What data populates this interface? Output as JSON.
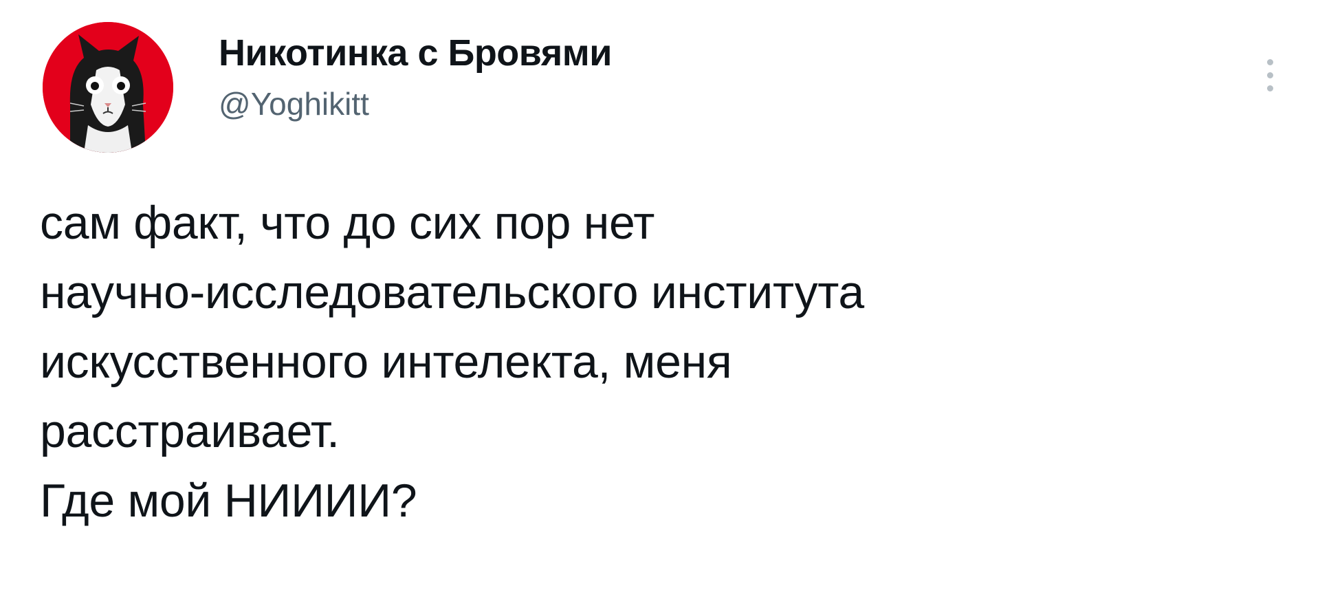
{
  "author": {
    "display_name": "Никотинка с Бровями",
    "handle": "@Yoghikitt",
    "avatar_icon": "cat-avatar-icon"
  },
  "menu": {
    "icon": "more-vertical-icon"
  },
  "tweet": {
    "lines": [
      "сам факт, что до сих пор нет",
      "научно-исследовательского института",
      "искусственного интелекта, меня",
      "расстраивает.",
      "Где мой НИИИИ?"
    ]
  },
  "colors": {
    "avatar_bg": "#e3001b",
    "handle": "#536471",
    "text": "#0f1419",
    "menu_dots": "#b8c0c6"
  }
}
